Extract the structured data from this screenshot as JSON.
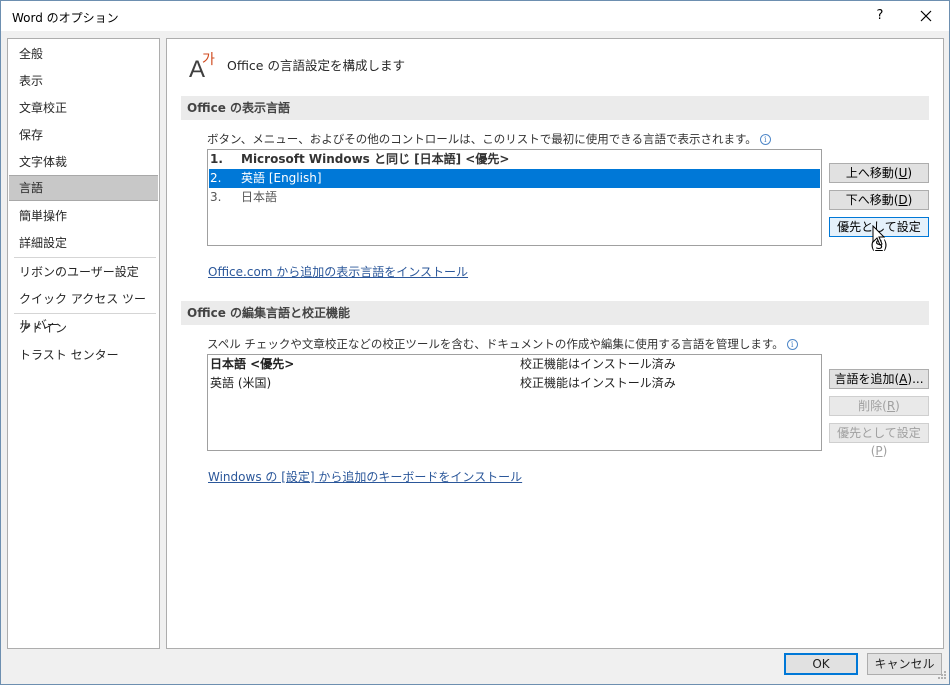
{
  "window": {
    "title": "Word のオプション",
    "help": "?"
  },
  "sidebar": {
    "items": [
      {
        "label": "全般"
      },
      {
        "label": "表示"
      },
      {
        "label": "文章校正"
      },
      {
        "label": "保存"
      },
      {
        "label": "文字体裁"
      },
      {
        "label": "言語",
        "selected": true
      },
      {
        "label": "簡単操作"
      },
      {
        "label": "詳細設定"
      },
      {
        "label": "リボンのユーザー設定"
      },
      {
        "label": "クイック アクセス ツール バー"
      },
      {
        "label": "アドイン"
      },
      {
        "label": "トラスト センター"
      }
    ]
  },
  "main": {
    "header_title": "Office の言語設定を構成します",
    "display_section": {
      "title": "Office の表示言語",
      "description": "ボタン、メニュー、およびその他のコントロールは、このリストで最初に使用できる言語で表示されます。",
      "languages": [
        {
          "num": "1.",
          "label": "Microsoft Windows と同じ [日本語] <優先>"
        },
        {
          "num": "2.",
          "label": "英語 [English]"
        },
        {
          "num": "3.",
          "label": "日本語"
        }
      ],
      "buttons": {
        "move_up": "上へ移動(",
        "move_up_key": "U",
        "move_down": "下へ移動(",
        "move_down_key": "D",
        "set_preferred": "優先として設定(",
        "set_preferred_key": "S",
        "close_paren": ")"
      },
      "install_link": "Office.com から追加の表示言語をインストール"
    },
    "editing_section": {
      "title": "Office の編集言語と校正機能",
      "description": "スペル チェックや文章校正などの校正ツールを含む、ドキュメントの作成や編集に使用する言語を管理します。",
      "languages": [
        {
          "label": "日本語 <優先>",
          "status": "校正機能はインストール済み"
        },
        {
          "label": "英語 (米国)",
          "status": "校正機能はインストール済み"
        }
      ],
      "buttons": {
        "add_language": "言語を追加(",
        "add_language_key": "A",
        "add_language_suffix": ")...",
        "remove": "削除(",
        "remove_key": "R",
        "set_preferred": "優先として設定(",
        "set_preferred_key": "P",
        "close_paren": ")"
      },
      "keyboard_link": "Windows の [設定] から追加のキーボードをインストール"
    }
  },
  "footer": {
    "ok": "OK",
    "cancel": "キャンセル"
  },
  "colors": {
    "selection": "#0078d7",
    "link": "#2b579a",
    "section_bar": "#ebebeb"
  }
}
